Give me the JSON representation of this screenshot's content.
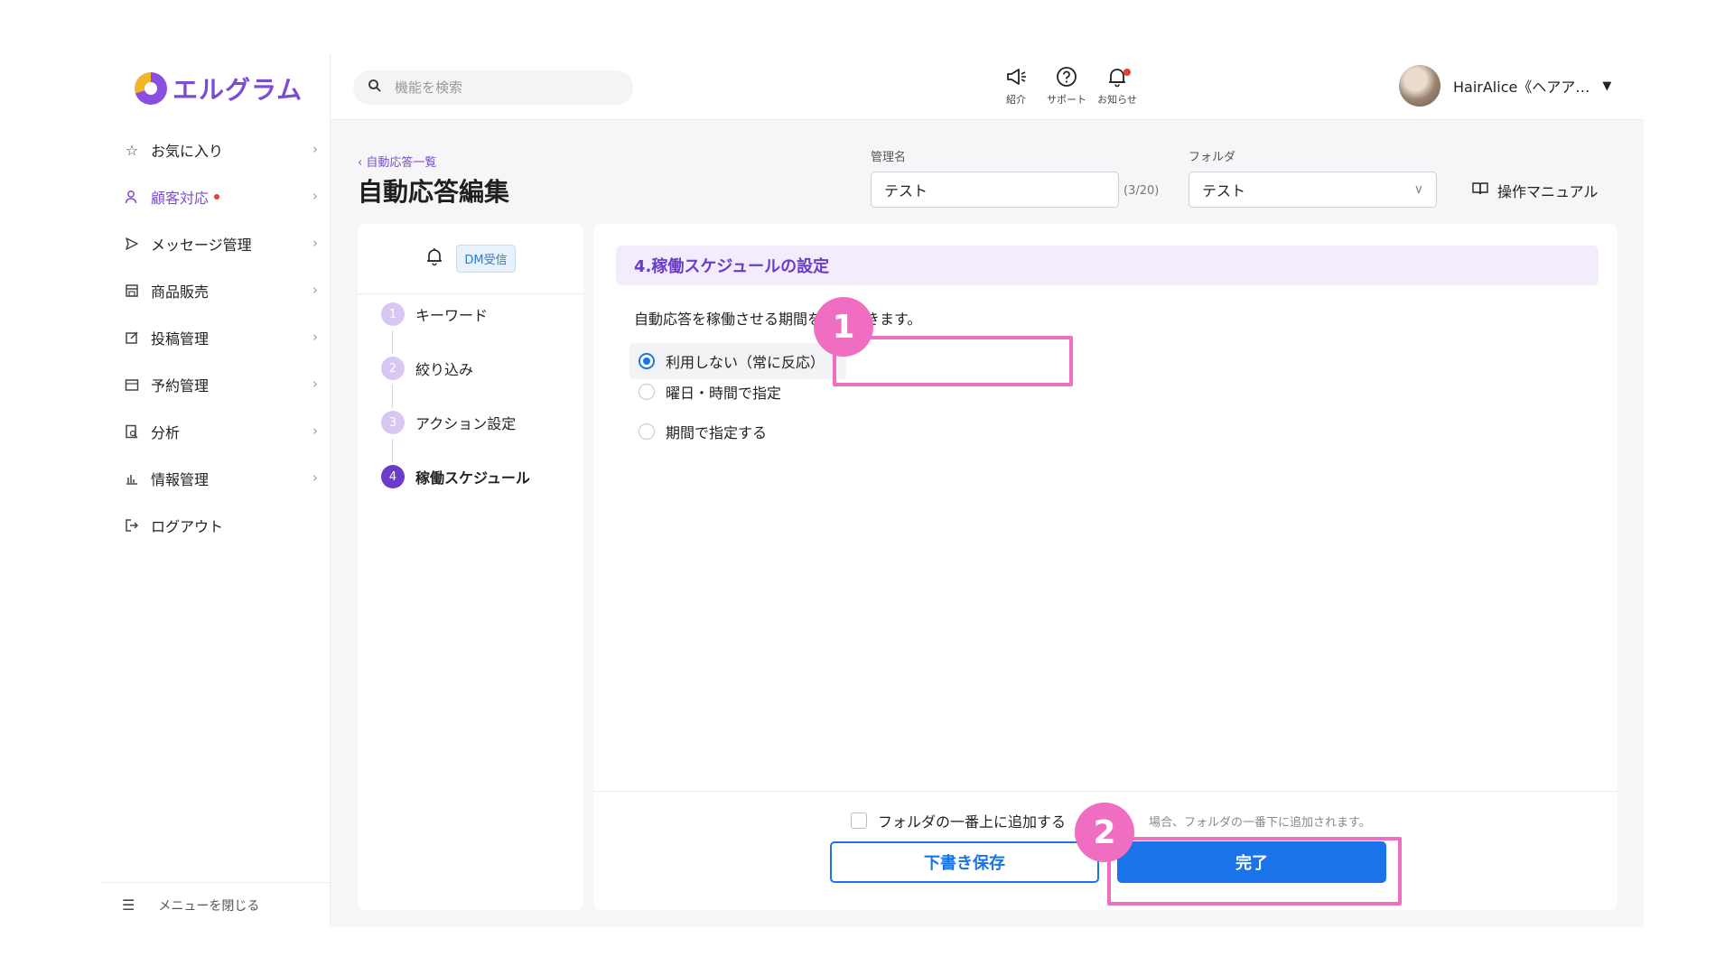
{
  "app": {
    "logo_text": "エルグラム",
    "brand_color": "#7b4bd6",
    "accent_color": "#1a73e8",
    "highlight_color": "#f06ec1"
  },
  "sidebar": {
    "items": [
      {
        "label": "お気に入り",
        "icon": "star-icon"
      },
      {
        "label": "顧客対応",
        "icon": "person-icon",
        "active": true,
        "has_dot": true
      },
      {
        "label": "メッセージ管理",
        "icon": "send-icon"
      },
      {
        "label": "商品販売",
        "icon": "store-icon"
      },
      {
        "label": "投稿管理",
        "icon": "edit-icon"
      },
      {
        "label": "予約管理",
        "icon": "calendar-icon"
      },
      {
        "label": "分析",
        "icon": "report-search-icon"
      },
      {
        "label": "情報管理",
        "icon": "bar-chart-icon"
      },
      {
        "label": "ログアウト",
        "icon": "logout-icon"
      }
    ],
    "collapse_label": "メニューを閉じる"
  },
  "header": {
    "search_placeholder": "機能を検索",
    "icons": [
      {
        "label": "紹介",
        "icon": "megaphone-icon"
      },
      {
        "label": "サポート",
        "icon": "help-icon"
      },
      {
        "label": "お知らせ",
        "icon": "bell-icon",
        "has_dot": true
      }
    ],
    "user_name": "HairAlice《ヘアア…"
  },
  "page": {
    "breadcrumb": "自動応答一覧",
    "title": "自動応答編集",
    "name_label": "管理名",
    "name_value": "テスト",
    "name_counter": "(3/20)",
    "folder_label": "フォルダ",
    "folder_value": "テスト",
    "manual_label": "操作マニュアル"
  },
  "steps": {
    "trigger_badge": "DM受信",
    "items": [
      {
        "num": "1",
        "label": "キーワード"
      },
      {
        "num": "2",
        "label": "絞り込み"
      },
      {
        "num": "3",
        "label": "アクション設定"
      },
      {
        "num": "4",
        "label": "稼働スケジュール",
        "current": true
      }
    ]
  },
  "schedule": {
    "section_title": "4.稼働スケジュールの設定",
    "description": "自動応答を稼働させる期間を設定できます。",
    "options": [
      {
        "label": "利用しない（常に反応）",
        "selected": true
      },
      {
        "label": "曜日・時間で指定",
        "selected": false
      },
      {
        "label": "期間で指定する",
        "selected": false
      }
    ]
  },
  "footer": {
    "checkbox_label": "フォルダの一番上に追加する",
    "hint": "場合、フォルダの一番下に追加されます。",
    "draft_button": "下書き保存",
    "done_button": "完了"
  },
  "annotations": {
    "badge1": "1",
    "badge2": "2"
  }
}
